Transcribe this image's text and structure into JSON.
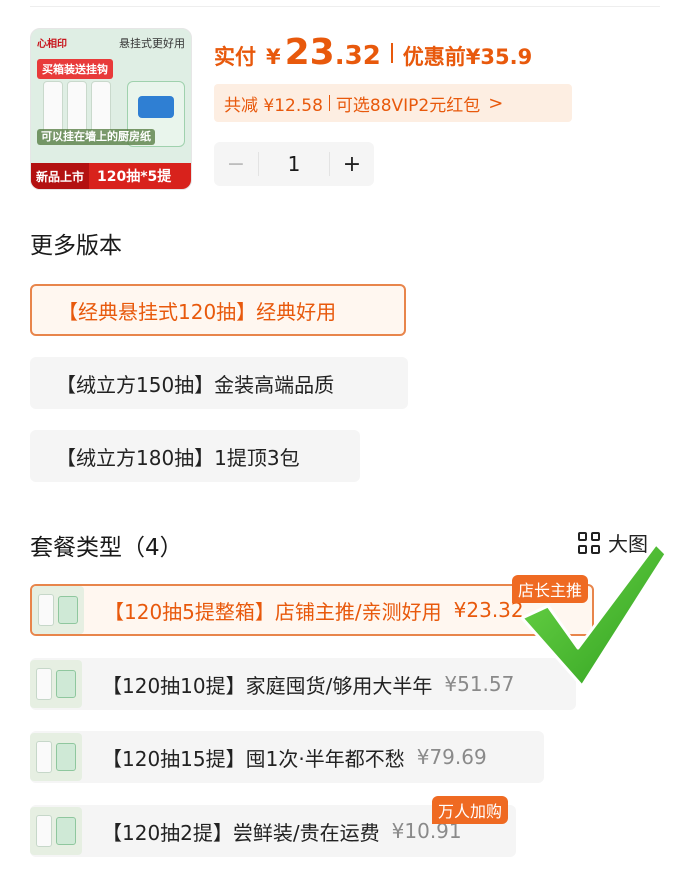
{
  "product": {
    "thumb": {
      "brand": "心相印",
      "tagline": "悬挂式更好用",
      "sticker": "买箱装送挂钩",
      "caption": "可以挂在墙上的厨房纸",
      "new_label": "新品上市",
      "spec": "120抽*5提"
    },
    "price": {
      "label": "实付",
      "currency": "¥",
      "integer": "23",
      "decimal": ".32",
      "before_label": "优惠前",
      "before_value": "¥35.9"
    },
    "discount": {
      "total": "共减 ¥12.58",
      "vip": "可选88VIP2元红包",
      "chevron": ">"
    },
    "quantity": {
      "minus": "−",
      "value": "1",
      "plus": "+"
    }
  },
  "versions": {
    "title": "更多版本",
    "items": [
      {
        "label": "【经典悬挂式120抽】经典好用",
        "selected": true
      },
      {
        "label": "【绒立方150抽】金装高端品质",
        "selected": false
      },
      {
        "label": "【绒立方180抽】1提顶3包",
        "selected": false
      }
    ]
  },
  "packages": {
    "title": "套餐类型（4）",
    "big_view": "大图",
    "items": [
      {
        "label": "【120抽5提整箱】店铺主推/亲测好用",
        "price": "¥23.32",
        "badge": "店长主推",
        "selected": true
      },
      {
        "label": "【120抽10提】家庭囤货/够用大半年",
        "price": "¥51.57",
        "badge": "",
        "selected": false
      },
      {
        "label": "【120抽15提】囤1次·半年都不愁",
        "price": "¥79.69",
        "badge": "",
        "selected": false
      },
      {
        "label": "【120抽2提】尝鲜装/贵在运费",
        "price": "¥10.91",
        "badge": "万人加购",
        "selected": false
      }
    ]
  },
  "colors": {
    "accent": "#e8590c",
    "selected_border": "#e8854b",
    "badge": "#ef6a22",
    "check_green": "#3cb12a"
  }
}
